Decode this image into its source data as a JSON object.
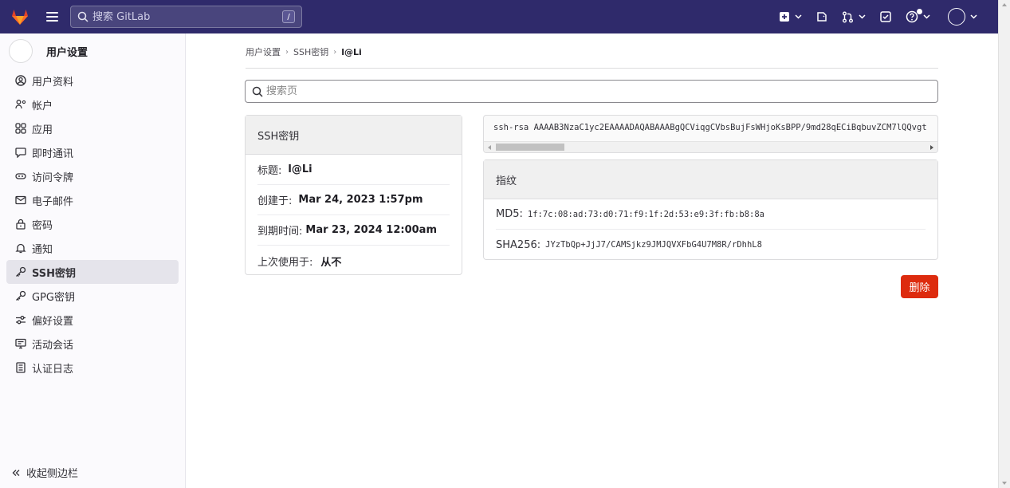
{
  "topbar": {
    "search_placeholder": "搜索 GitLab",
    "search_shortcut": "/"
  },
  "sidebar": {
    "title": "用户设置",
    "items": [
      {
        "label": "用户资料",
        "icon": "profile-icon"
      },
      {
        "label": "帐户",
        "icon": "account-icon"
      },
      {
        "label": "应用",
        "icon": "applications-icon"
      },
      {
        "label": "即时通讯",
        "icon": "chat-icon"
      },
      {
        "label": "访问令牌",
        "icon": "token-icon"
      },
      {
        "label": "电子邮件",
        "icon": "mail-icon"
      },
      {
        "label": "密码",
        "icon": "lock-icon"
      },
      {
        "label": "通知",
        "icon": "bell-icon"
      },
      {
        "label": "SSH密钥",
        "icon": "key-icon",
        "active": true
      },
      {
        "label": "GPG密钥",
        "icon": "key-icon"
      },
      {
        "label": "偏好设置",
        "icon": "preferences-icon"
      },
      {
        "label": "活动会话",
        "icon": "sessions-icon"
      },
      {
        "label": "认证日志",
        "icon": "log-icon"
      }
    ],
    "collapse_label": "收起侧边栏"
  },
  "breadcrumb": {
    "items": [
      "用户设置",
      "SSH密钥"
    ],
    "current": "l@Li"
  },
  "page_search": {
    "placeholder": "搜索页"
  },
  "ssh_key": {
    "header": "SSH密钥",
    "title_label": "标题:",
    "title_value": "l@Li",
    "created_label": "创建于:",
    "created_value": "Mar 24, 2023 1:57pm",
    "expires_label": "到期时间:",
    "expires_value": "Mar 23, 2024 12:00am",
    "last_used_label": "上次使用于:",
    "last_used_value": "从不",
    "key_text": "ssh-rsa AAAAB3NzaC1yc2EAAAADAQABAAABgQCViqgCVbsBujFsWHjoKsBPP/9md28qECiBqbuvZCM7lQQvgt"
  },
  "fingerprints": {
    "header": "指纹",
    "md5_label": "MD5:",
    "md5_value": "1f:7c:08:ad:73:d0:71:f9:1f:2d:53:e9:3f:fb:b8:8a",
    "sha256_label": "SHA256:",
    "sha256_value": "JYzTbQp+JjJ7/CAMSjkz9JMJQVXFbG4U7M8R/rDhhL8"
  },
  "actions": {
    "delete_label": "删除"
  },
  "colors": {
    "topbar": "#2f2a6b",
    "danger": "#dd2b0e",
    "sidebar_active": "#e5e4eb"
  }
}
